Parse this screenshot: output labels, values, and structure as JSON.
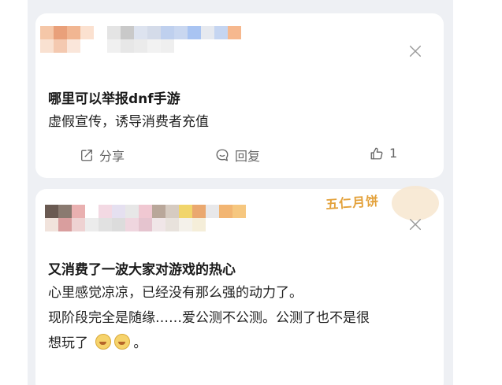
{
  "posts": [
    {
      "title": "哪里可以举报dnf手游",
      "body": [
        "虚假宣传，诱导消费者充值"
      ],
      "actions": {
        "share": "分享",
        "reply": "回复",
        "likes": "1"
      },
      "icons": [
        "share-icon",
        "comment-icon",
        "thumbs-up-icon",
        "close-icon"
      ]
    },
    {
      "title": "又消费了一波大家对游戏的热心",
      "body": [
        "心里感觉凉凉，已经没有那么强的动力了。",
        "现阶段完全是随缘……爱公测不公测。公测了也不是很",
        "想玩了",
        "。"
      ],
      "badge": "五仁月饼",
      "icons": [
        "close-icon",
        "laughing-emoji-icon"
      ]
    }
  ],
  "colors": {
    "background": "#eef0f4",
    "card": "#ffffff",
    "text": "#1a1a1a",
    "muted": "#666666",
    "badge": "#e3a13a"
  }
}
